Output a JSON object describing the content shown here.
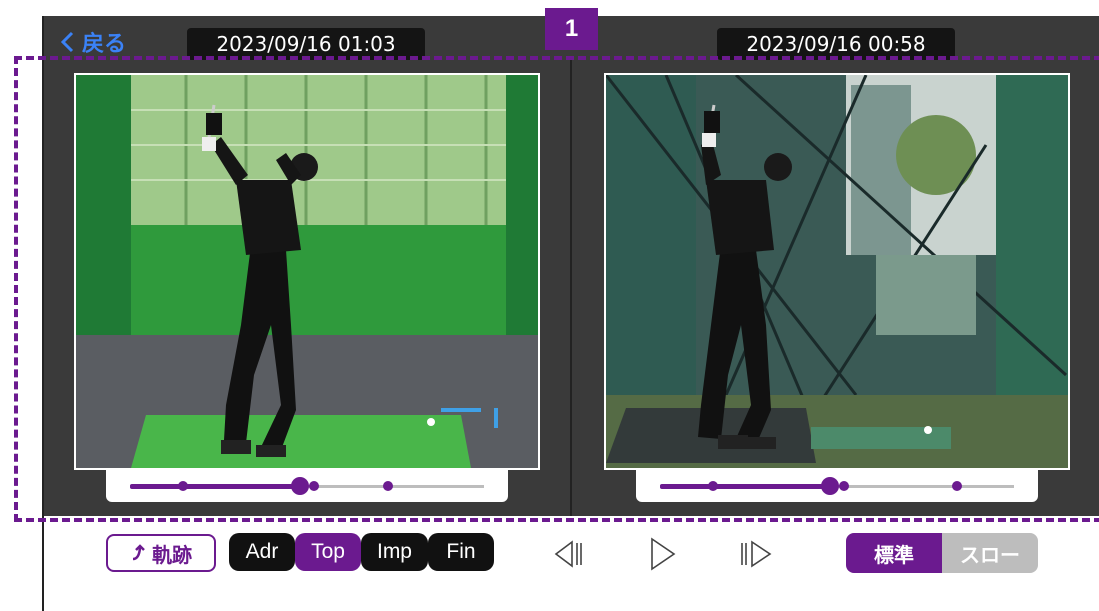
{
  "header": {
    "back_label": "戻る",
    "annotation_number": "1"
  },
  "videos": [
    {
      "timestamp": "2023/09/16 01:03",
      "slider": {
        "position": 0.48,
        "markers": [
          0.15,
          0.52,
          0.73
        ]
      }
    },
    {
      "timestamp": "2023/09/16 00:58",
      "slider": {
        "position": 0.48,
        "markers": [
          0.15,
          0.52,
          0.84
        ]
      }
    }
  ],
  "toolbar": {
    "trajectory_label": "軌跡",
    "phases": [
      {
        "label": "Adr",
        "active": false
      },
      {
        "label": "Top",
        "active": true
      },
      {
        "label": "Imp",
        "active": false
      },
      {
        "label": "Fin",
        "active": false
      }
    ],
    "playback_icons": [
      "step-back-icon",
      "play-icon",
      "step-forward-icon"
    ],
    "speed": [
      {
        "label": "標準",
        "active": true
      },
      {
        "label": "スロー",
        "active": false
      }
    ]
  },
  "colors": {
    "accent": "#6b1a8f",
    "back_link": "#3b82f6",
    "panel_background": "#3a3a3a",
    "inactive_speed": "#bdbdbd"
  }
}
